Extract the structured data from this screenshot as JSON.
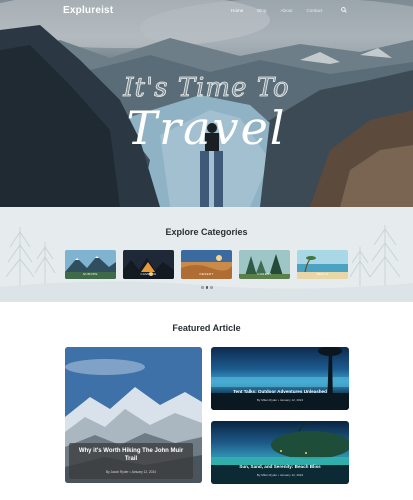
{
  "nav": {
    "logo": "Explureist",
    "links": [
      "Home",
      "Blog",
      "About",
      "Contact"
    ],
    "active_index": 0
  },
  "hero": {
    "title_line1": "It's Time To",
    "title_line2": "Travel"
  },
  "categories": {
    "heading": "Explore Categories",
    "items": [
      {
        "label": "EUROPE"
      },
      {
        "label": "CAMPING"
      },
      {
        "label": "DESERT"
      },
      {
        "label": "FOREST"
      },
      {
        "label": "BEACH"
      }
    ],
    "pagination_dots": 3,
    "active_dot": 1
  },
  "featured": {
    "heading": "Featured Article",
    "main": {
      "title": "Why it's Worth Hiking The John Muir Trail",
      "meta": "By Jacob Ryder  •  January 12, 2024"
    },
    "side": [
      {
        "title": "Tent Talks: Outdoor Adventures Unleashed",
        "meta": "By Milan Ryder  •  January 12, 2024"
      },
      {
        "title": "Sun, Sand, and Serenity: Beach Bliss",
        "meta": "By Milan Ryder  •  January 12, 2024"
      }
    ]
  },
  "colors": {
    "heading_text": "#2a2f33",
    "category_band": "#e6ecee",
    "white": "#ffffff"
  },
  "icons": {
    "search": "search-icon"
  }
}
